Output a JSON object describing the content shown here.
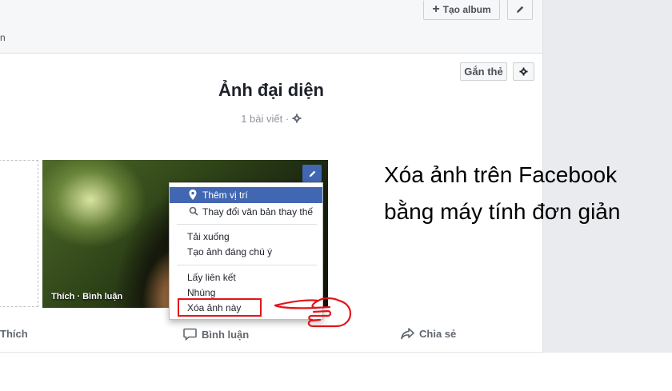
{
  "header": {
    "left_fragment": "n",
    "create_album_label": "Tạo album",
    "plus_icon": "+"
  },
  "album": {
    "tag_button_label": "Gắn thẻ",
    "title": "Ảnh đại diện",
    "meta": "1 bài viết ·"
  },
  "photo": {
    "caption": "Thích · Bình luận"
  },
  "menu": {
    "items": [
      {
        "label": "Thêm vị trí",
        "icon": "location-pin-icon"
      },
      {
        "label": "Thay đổi văn bản thay thế",
        "icon": "search-icon"
      },
      {
        "label": "Tải xuống"
      },
      {
        "label": "Tạo ảnh đáng chú ý"
      },
      {
        "label": "Lấy liên kết"
      },
      {
        "label": "Nhúng"
      },
      {
        "label": "Xóa ảnh này"
      }
    ]
  },
  "actions": {
    "like": "Thích",
    "comment": "Bình luận",
    "share": "Chia sẻ"
  },
  "overlay": {
    "line1": "Xóa ảnh trên Facebook",
    "line2": "bằng máy tính đơn giản"
  },
  "colors": {
    "fb_blue": "#4267b2",
    "highlight_red": "#e0151c"
  }
}
